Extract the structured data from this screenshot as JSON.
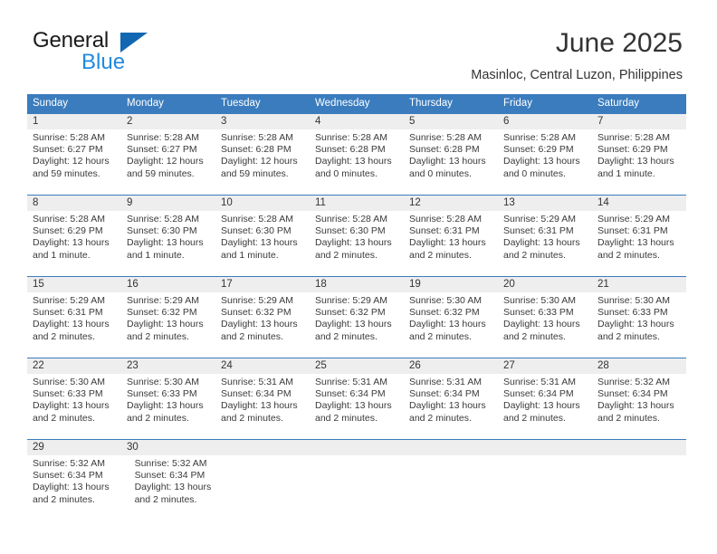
{
  "brand": {
    "name_top": "General",
    "name_bottom": "Blue",
    "triangle_color": "#1267b2",
    "blue_text_color": "#1f8ae0"
  },
  "header": {
    "month_title": "June 2025",
    "location": "Masinloc, Central Luzon, Philippines"
  },
  "colors": {
    "header_blue": "#3a7cbe",
    "daynum_band": "#eeeeee",
    "text": "#333333"
  },
  "weekdays": [
    "Sunday",
    "Monday",
    "Tuesday",
    "Wednesday",
    "Thursday",
    "Friday",
    "Saturday"
  ],
  "weeks": [
    {
      "days": [
        {
          "num": "1",
          "sunrise": "Sunrise: 5:28 AM",
          "sunset": "Sunset: 6:27 PM",
          "daylight": "Daylight: 12 hours and 59 minutes."
        },
        {
          "num": "2",
          "sunrise": "Sunrise: 5:28 AM",
          "sunset": "Sunset: 6:27 PM",
          "daylight": "Daylight: 12 hours and 59 minutes."
        },
        {
          "num": "3",
          "sunrise": "Sunrise: 5:28 AM",
          "sunset": "Sunset: 6:28 PM",
          "daylight": "Daylight: 12 hours and 59 minutes."
        },
        {
          "num": "4",
          "sunrise": "Sunrise: 5:28 AM",
          "sunset": "Sunset: 6:28 PM",
          "daylight": "Daylight: 13 hours and 0 minutes."
        },
        {
          "num": "5",
          "sunrise": "Sunrise: 5:28 AM",
          "sunset": "Sunset: 6:28 PM",
          "daylight": "Daylight: 13 hours and 0 minutes."
        },
        {
          "num": "6",
          "sunrise": "Sunrise: 5:28 AM",
          "sunset": "Sunset: 6:29 PM",
          "daylight": "Daylight: 13 hours and 0 minutes."
        },
        {
          "num": "7",
          "sunrise": "Sunrise: 5:28 AM",
          "sunset": "Sunset: 6:29 PM",
          "daylight": "Daylight: 13 hours and 1 minute."
        }
      ]
    },
    {
      "days": [
        {
          "num": "8",
          "sunrise": "Sunrise: 5:28 AM",
          "sunset": "Sunset: 6:29 PM",
          "daylight": "Daylight: 13 hours and 1 minute."
        },
        {
          "num": "9",
          "sunrise": "Sunrise: 5:28 AM",
          "sunset": "Sunset: 6:30 PM",
          "daylight": "Daylight: 13 hours and 1 minute."
        },
        {
          "num": "10",
          "sunrise": "Sunrise: 5:28 AM",
          "sunset": "Sunset: 6:30 PM",
          "daylight": "Daylight: 13 hours and 1 minute."
        },
        {
          "num": "11",
          "sunrise": "Sunrise: 5:28 AM",
          "sunset": "Sunset: 6:30 PM",
          "daylight": "Daylight: 13 hours and 2 minutes."
        },
        {
          "num": "12",
          "sunrise": "Sunrise: 5:28 AM",
          "sunset": "Sunset: 6:31 PM",
          "daylight": "Daylight: 13 hours and 2 minutes."
        },
        {
          "num": "13",
          "sunrise": "Sunrise: 5:29 AM",
          "sunset": "Sunset: 6:31 PM",
          "daylight": "Daylight: 13 hours and 2 minutes."
        },
        {
          "num": "14",
          "sunrise": "Sunrise: 5:29 AM",
          "sunset": "Sunset: 6:31 PM",
          "daylight": "Daylight: 13 hours and 2 minutes."
        }
      ]
    },
    {
      "days": [
        {
          "num": "15",
          "sunrise": "Sunrise: 5:29 AM",
          "sunset": "Sunset: 6:31 PM",
          "daylight": "Daylight: 13 hours and 2 minutes."
        },
        {
          "num": "16",
          "sunrise": "Sunrise: 5:29 AM",
          "sunset": "Sunset: 6:32 PM",
          "daylight": "Daylight: 13 hours and 2 minutes."
        },
        {
          "num": "17",
          "sunrise": "Sunrise: 5:29 AM",
          "sunset": "Sunset: 6:32 PM",
          "daylight": "Daylight: 13 hours and 2 minutes."
        },
        {
          "num": "18",
          "sunrise": "Sunrise: 5:29 AM",
          "sunset": "Sunset: 6:32 PM",
          "daylight": "Daylight: 13 hours and 2 minutes."
        },
        {
          "num": "19",
          "sunrise": "Sunrise: 5:30 AM",
          "sunset": "Sunset: 6:32 PM",
          "daylight": "Daylight: 13 hours and 2 minutes."
        },
        {
          "num": "20",
          "sunrise": "Sunrise: 5:30 AM",
          "sunset": "Sunset: 6:33 PM",
          "daylight": "Daylight: 13 hours and 2 minutes."
        },
        {
          "num": "21",
          "sunrise": "Sunrise: 5:30 AM",
          "sunset": "Sunset: 6:33 PM",
          "daylight": "Daylight: 13 hours and 2 minutes."
        }
      ]
    },
    {
      "days": [
        {
          "num": "22",
          "sunrise": "Sunrise: 5:30 AM",
          "sunset": "Sunset: 6:33 PM",
          "daylight": "Daylight: 13 hours and 2 minutes."
        },
        {
          "num": "23",
          "sunrise": "Sunrise: 5:30 AM",
          "sunset": "Sunset: 6:33 PM",
          "daylight": "Daylight: 13 hours and 2 minutes."
        },
        {
          "num": "24",
          "sunrise": "Sunrise: 5:31 AM",
          "sunset": "Sunset: 6:34 PM",
          "daylight": "Daylight: 13 hours and 2 minutes."
        },
        {
          "num": "25",
          "sunrise": "Sunrise: 5:31 AM",
          "sunset": "Sunset: 6:34 PM",
          "daylight": "Daylight: 13 hours and 2 minutes."
        },
        {
          "num": "26",
          "sunrise": "Sunrise: 5:31 AM",
          "sunset": "Sunset: 6:34 PM",
          "daylight": "Daylight: 13 hours and 2 minutes."
        },
        {
          "num": "27",
          "sunrise": "Sunrise: 5:31 AM",
          "sunset": "Sunset: 6:34 PM",
          "daylight": "Daylight: 13 hours and 2 minutes."
        },
        {
          "num": "28",
          "sunrise": "Sunrise: 5:32 AM",
          "sunset": "Sunset: 6:34 PM",
          "daylight": "Daylight: 13 hours and 2 minutes."
        }
      ]
    },
    {
      "days": [
        {
          "num": "29",
          "sunrise": "Sunrise: 5:32 AM",
          "sunset": "Sunset: 6:34 PM",
          "daylight": "Daylight: 13 hours and 2 minutes."
        },
        {
          "num": "30",
          "sunrise": "Sunrise: 5:32 AM",
          "sunset": "Sunset: 6:34 PM",
          "daylight": "Daylight: 13 hours and 2 minutes."
        }
      ]
    }
  ]
}
